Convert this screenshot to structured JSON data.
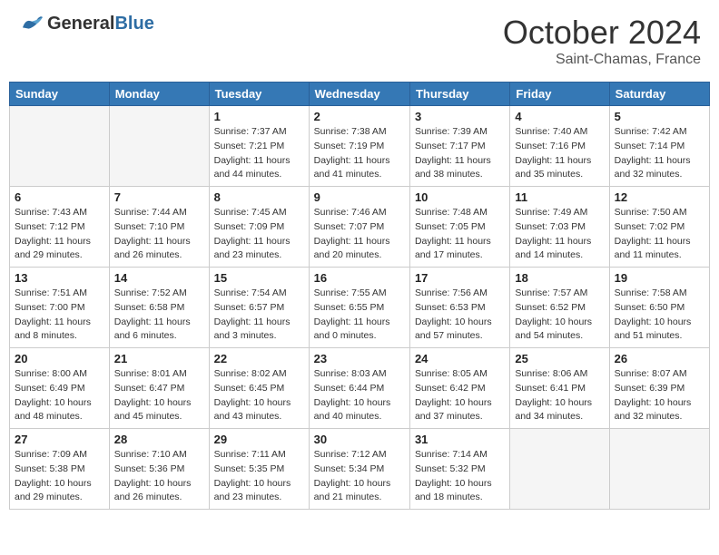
{
  "header": {
    "logo_general": "General",
    "logo_blue": "Blue",
    "month": "October 2024",
    "location": "Saint-Chamas, France"
  },
  "days_of_week": [
    "Sunday",
    "Monday",
    "Tuesday",
    "Wednesday",
    "Thursday",
    "Friday",
    "Saturday"
  ],
  "weeks": [
    [
      {
        "day": "",
        "sunrise": "",
        "sunset": "",
        "daylight": ""
      },
      {
        "day": "",
        "sunrise": "",
        "sunset": "",
        "daylight": ""
      },
      {
        "day": "1",
        "sunrise": "Sunrise: 7:37 AM",
        "sunset": "Sunset: 7:21 PM",
        "daylight": "Daylight: 11 hours and 44 minutes."
      },
      {
        "day": "2",
        "sunrise": "Sunrise: 7:38 AM",
        "sunset": "Sunset: 7:19 PM",
        "daylight": "Daylight: 11 hours and 41 minutes."
      },
      {
        "day": "3",
        "sunrise": "Sunrise: 7:39 AM",
        "sunset": "Sunset: 7:17 PM",
        "daylight": "Daylight: 11 hours and 38 minutes."
      },
      {
        "day": "4",
        "sunrise": "Sunrise: 7:40 AM",
        "sunset": "Sunset: 7:16 PM",
        "daylight": "Daylight: 11 hours and 35 minutes."
      },
      {
        "day": "5",
        "sunrise": "Sunrise: 7:42 AM",
        "sunset": "Sunset: 7:14 PM",
        "daylight": "Daylight: 11 hours and 32 minutes."
      }
    ],
    [
      {
        "day": "6",
        "sunrise": "Sunrise: 7:43 AM",
        "sunset": "Sunset: 7:12 PM",
        "daylight": "Daylight: 11 hours and 29 minutes."
      },
      {
        "day": "7",
        "sunrise": "Sunrise: 7:44 AM",
        "sunset": "Sunset: 7:10 PM",
        "daylight": "Daylight: 11 hours and 26 minutes."
      },
      {
        "day": "8",
        "sunrise": "Sunrise: 7:45 AM",
        "sunset": "Sunset: 7:09 PM",
        "daylight": "Daylight: 11 hours and 23 minutes."
      },
      {
        "day": "9",
        "sunrise": "Sunrise: 7:46 AM",
        "sunset": "Sunset: 7:07 PM",
        "daylight": "Daylight: 11 hours and 20 minutes."
      },
      {
        "day": "10",
        "sunrise": "Sunrise: 7:48 AM",
        "sunset": "Sunset: 7:05 PM",
        "daylight": "Daylight: 11 hours and 17 minutes."
      },
      {
        "day": "11",
        "sunrise": "Sunrise: 7:49 AM",
        "sunset": "Sunset: 7:03 PM",
        "daylight": "Daylight: 11 hours and 14 minutes."
      },
      {
        "day": "12",
        "sunrise": "Sunrise: 7:50 AM",
        "sunset": "Sunset: 7:02 PM",
        "daylight": "Daylight: 11 hours and 11 minutes."
      }
    ],
    [
      {
        "day": "13",
        "sunrise": "Sunrise: 7:51 AM",
        "sunset": "Sunset: 7:00 PM",
        "daylight": "Daylight: 11 hours and 8 minutes."
      },
      {
        "day": "14",
        "sunrise": "Sunrise: 7:52 AM",
        "sunset": "Sunset: 6:58 PM",
        "daylight": "Daylight: 11 hours and 6 minutes."
      },
      {
        "day": "15",
        "sunrise": "Sunrise: 7:54 AM",
        "sunset": "Sunset: 6:57 PM",
        "daylight": "Daylight: 11 hours and 3 minutes."
      },
      {
        "day": "16",
        "sunrise": "Sunrise: 7:55 AM",
        "sunset": "Sunset: 6:55 PM",
        "daylight": "Daylight: 11 hours and 0 minutes."
      },
      {
        "day": "17",
        "sunrise": "Sunrise: 7:56 AM",
        "sunset": "Sunset: 6:53 PM",
        "daylight": "Daylight: 10 hours and 57 minutes."
      },
      {
        "day": "18",
        "sunrise": "Sunrise: 7:57 AM",
        "sunset": "Sunset: 6:52 PM",
        "daylight": "Daylight: 10 hours and 54 minutes."
      },
      {
        "day": "19",
        "sunrise": "Sunrise: 7:58 AM",
        "sunset": "Sunset: 6:50 PM",
        "daylight": "Daylight: 10 hours and 51 minutes."
      }
    ],
    [
      {
        "day": "20",
        "sunrise": "Sunrise: 8:00 AM",
        "sunset": "Sunset: 6:49 PM",
        "daylight": "Daylight: 10 hours and 48 minutes."
      },
      {
        "day": "21",
        "sunrise": "Sunrise: 8:01 AM",
        "sunset": "Sunset: 6:47 PM",
        "daylight": "Daylight: 10 hours and 45 minutes."
      },
      {
        "day": "22",
        "sunrise": "Sunrise: 8:02 AM",
        "sunset": "Sunset: 6:45 PM",
        "daylight": "Daylight: 10 hours and 43 minutes."
      },
      {
        "day": "23",
        "sunrise": "Sunrise: 8:03 AM",
        "sunset": "Sunset: 6:44 PM",
        "daylight": "Daylight: 10 hours and 40 minutes."
      },
      {
        "day": "24",
        "sunrise": "Sunrise: 8:05 AM",
        "sunset": "Sunset: 6:42 PM",
        "daylight": "Daylight: 10 hours and 37 minutes."
      },
      {
        "day": "25",
        "sunrise": "Sunrise: 8:06 AM",
        "sunset": "Sunset: 6:41 PM",
        "daylight": "Daylight: 10 hours and 34 minutes."
      },
      {
        "day": "26",
        "sunrise": "Sunrise: 8:07 AM",
        "sunset": "Sunset: 6:39 PM",
        "daylight": "Daylight: 10 hours and 32 minutes."
      }
    ],
    [
      {
        "day": "27",
        "sunrise": "Sunrise: 7:09 AM",
        "sunset": "Sunset: 5:38 PM",
        "daylight": "Daylight: 10 hours and 29 minutes."
      },
      {
        "day": "28",
        "sunrise": "Sunrise: 7:10 AM",
        "sunset": "Sunset: 5:36 PM",
        "daylight": "Daylight: 10 hours and 26 minutes."
      },
      {
        "day": "29",
        "sunrise": "Sunrise: 7:11 AM",
        "sunset": "Sunset: 5:35 PM",
        "daylight": "Daylight: 10 hours and 23 minutes."
      },
      {
        "day": "30",
        "sunrise": "Sunrise: 7:12 AM",
        "sunset": "Sunset: 5:34 PM",
        "daylight": "Daylight: 10 hours and 21 minutes."
      },
      {
        "day": "31",
        "sunrise": "Sunrise: 7:14 AM",
        "sunset": "Sunset: 5:32 PM",
        "daylight": "Daylight: 10 hours and 18 minutes."
      },
      {
        "day": "",
        "sunrise": "",
        "sunset": "",
        "daylight": ""
      },
      {
        "day": "",
        "sunrise": "",
        "sunset": "",
        "daylight": ""
      }
    ]
  ]
}
